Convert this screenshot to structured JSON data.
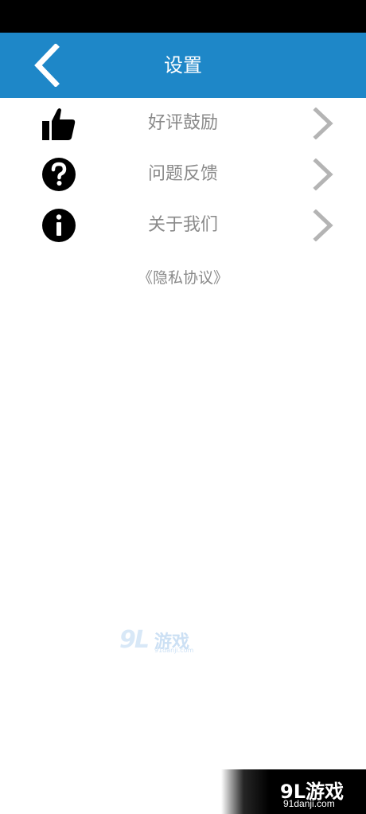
{
  "header": {
    "title": "设置",
    "back_icon": "chevron-left-icon",
    "background_color": "#1e87c8"
  },
  "menu": {
    "items": [
      {
        "label": "好评鼓励",
        "icon": "thumbs-up-icon"
      },
      {
        "label": "问题反馈",
        "icon": "question-circle-icon"
      },
      {
        "label": "关于我们",
        "icon": "info-circle-icon"
      }
    ],
    "chevron_icon": "chevron-right-icon",
    "label_color": "#8a8a8a"
  },
  "privacy_link": "《隐私协议》",
  "watermark": {
    "brand_number": "9L",
    "brand_name": "游戏",
    "domain": "91danji.com"
  }
}
